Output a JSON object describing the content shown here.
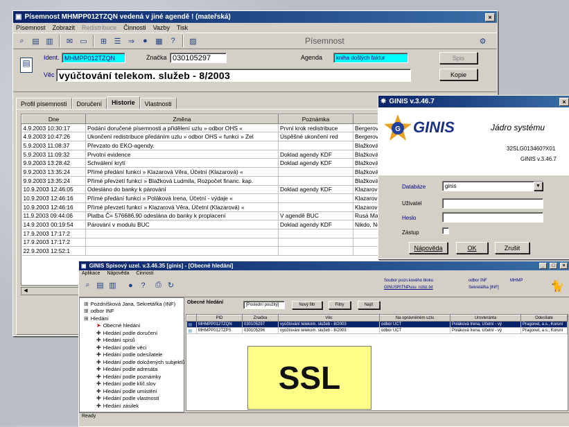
{
  "main_window": {
    "title": "Písemnost MHMPP012TZQN vedená v jiné agendě ! (mateřská)",
    "menu": [
      "Písemnost",
      "Zobrazit",
      "Redistribuce",
      "Činnosti",
      "Vazby",
      "Tisk"
    ],
    "menu_disabled": [
      false,
      false,
      true,
      false,
      false,
      false
    ],
    "toolbar_label": "Písemnost",
    "ident_label": "Ident.",
    "ident_value": "MHMPP012TZQN",
    "znacka_label": "Značka",
    "znacka_value": "030105297",
    "agenda_label": "Agenda",
    "agenda_value": "kniha došlých faktur",
    "vec_label": "Věc",
    "vec_value": "vyúčtování telekom. služeb - 8/2003",
    "btn_spis": "Spis",
    "btn_kopie": "Kopie",
    "tabs": [
      "Profil písemnosti",
      "Doručení",
      "Historie",
      "Vlastnosti"
    ],
    "table": {
      "headers": [
        "Dne",
        "Změna",
        "Poznámka",
        "Změ"
      ],
      "rows": [
        [
          "4.9.2003 10:30:17",
          "Podání doručené písemnosti a přidělení uzlu » odbor OHS «",
          "První krok redistribuce",
          "Bergerová"
        ],
        [
          "4.9.2003 10:47:26",
          "Ukončení redistribuce předáním uzlu » odbor OHS « funkci » Zel",
          "Úspěšné ukončení red",
          "Bergerová"
        ],
        [
          "5.9.2003 11:08:37",
          "Převzato do EKO-agendy.",
          "",
          "Blažková"
        ],
        [
          "5.9.2003 11:09:32",
          "Prvotní evidence",
          "Doklad agendy KDF",
          "Blažková"
        ],
        [
          "9.9.2003 13:28:42",
          "Schválení krytí",
          "Doklad agendy KDF",
          "Blažková"
        ],
        [
          "9.9.2003 13:35:24",
          "Přímé předání funkci » Klazarová Věra, Účetní (Klazarová) «",
          "",
          "Blažková"
        ],
        [
          "9.9.2003 13:35:24",
          "Přímé převzetí funkcí » Blažková Ludmila, Rozpočet financ. kap.",
          "",
          "Blažková"
        ],
        [
          "10.9.2003 12:46:05",
          "Odesláno do banky k párování",
          "Doklad agendy KDF",
          "Klazarová"
        ],
        [
          "10.9.2003 12:46:16",
          "Přímé předání funkci » Poláková Irena, Účetní - výdaje «",
          "",
          "Klazarová"
        ],
        [
          "10.9.2003 12:46:16",
          "Přímé převzetí funkcí » Klazarová Věra, Účetní (Klazarová) «",
          "",
          "Klazarová"
        ],
        [
          "11.9.2003 09:44:06",
          "Platba Č= 576686.90 odeslána do banky k proplacení",
          "V agendě BUC",
          "Rusá Mart"
        ],
        [
          "14.9.2003 00:19:54",
          "Párování v modulu BUC",
          "Doklad agendy KDF",
          "Nikdo, Neb"
        ],
        [
          "17.9.2003 17:17:2",
          "",
          "",
          ""
        ],
        [
          "17.9.2003 17:17:2",
          "",
          "",
          ""
        ],
        [
          "22.9.2003 12:52:1",
          "",
          "",
          ""
        ]
      ]
    }
  },
  "login_window": {
    "title": "GINIS v.3.46.7",
    "logo_text": "GINIS",
    "tagline": "Jádro systému",
    "code": "32SLG013460?X01",
    "version": "GINIS v.3.46.7",
    "databaze_label": "Databáze",
    "databaze_value": "ginis",
    "uzivatel_label": "Uživatel",
    "heslo_label": "Heslo",
    "zastup_label": "Zástup",
    "btn_napoveda": "Nápověda",
    "btn_ok": "OK",
    "btn_zrusit": "Zrušit"
  },
  "spisovy_window": {
    "title": "GINIS Spisový uzel. v.3.46.35 [ginis] - [Obecné hledání]",
    "menu": [
      "Aplikace",
      "Nápověda",
      "Činnosti"
    ],
    "info": [
      "Soubor pozn.kového bloku",
      "odbor INF",
      "MHMP"
    ],
    "info2": [
      "GINUSR\\TNPusu_nzbz.txt",
      "Sekretářka [INF]",
      ""
    ],
    "tree": [
      {
        "label": "Pozdníšková Jana, Sekretářka (INF)",
        "indent": 0
      },
      {
        "label": "odbor INF",
        "indent": 0
      },
      {
        "label": "Hledání",
        "indent": 0
      },
      {
        "label": "Obecné hledání",
        "indent": 1
      },
      {
        "label": "Hledání podle doručení",
        "indent": 1
      },
      {
        "label": "Hledání spisů",
        "indent": 1
      },
      {
        "label": "Hledání podle věci",
        "indent": 1
      },
      {
        "label": "Hledání podle odesílatele",
        "indent": 1
      },
      {
        "label": "Hledání podle doložených subjektů",
        "indent": 1
      },
      {
        "label": "Hledání podle adresáta",
        "indent": 1
      },
      {
        "label": "Hledání podle poznámky",
        "indent": 1
      },
      {
        "label": "Hledání podle klíč.slov",
        "indent": 1
      },
      {
        "label": "Hledání podle umístění",
        "indent": 1
      },
      {
        "label": "Hledání podle vlastností",
        "indent": 1
      },
      {
        "label": "Hledání zásilek",
        "indent": 1
      }
    ],
    "search_title": "Obecné hledání",
    "search_combo": "[Poslední použitý]",
    "btn_nova": "Nový filtr",
    "btn_filtry": "Filtry",
    "btn_najit": "Najít",
    "grid_headers": [
      "",
      "PID",
      "Značka",
      "Věc",
      "Na oprávněném uzlu",
      "Urovteránta",
      "Odesílate"
    ],
    "grid_rows": [
      [
        "",
        "MHMPP012TZQN",
        "030105297",
        "vyúčtování telekom. služeb - 8/2003",
        "odbor UCT",
        "Poláková Irena, Účetní - vý",
        "Pragonet, a.s., Koruní"
      ],
      [
        "",
        "MHMPP012TZPS",
        "030105296",
        "vyúčtování telekom. služeb - 8/2003",
        "odbor UCT",
        "Poláková Irena, Účetní - vý",
        "Pragonet, a.s., Koruní"
      ]
    ],
    "status": "Ready"
  },
  "ssl_label": "SSL",
  "colors": {
    "titlebar": "#0a246a",
    "selection_blue": "#0a246a",
    "ident_field": "#00ffff",
    "ssl_box": "#ffff88"
  }
}
